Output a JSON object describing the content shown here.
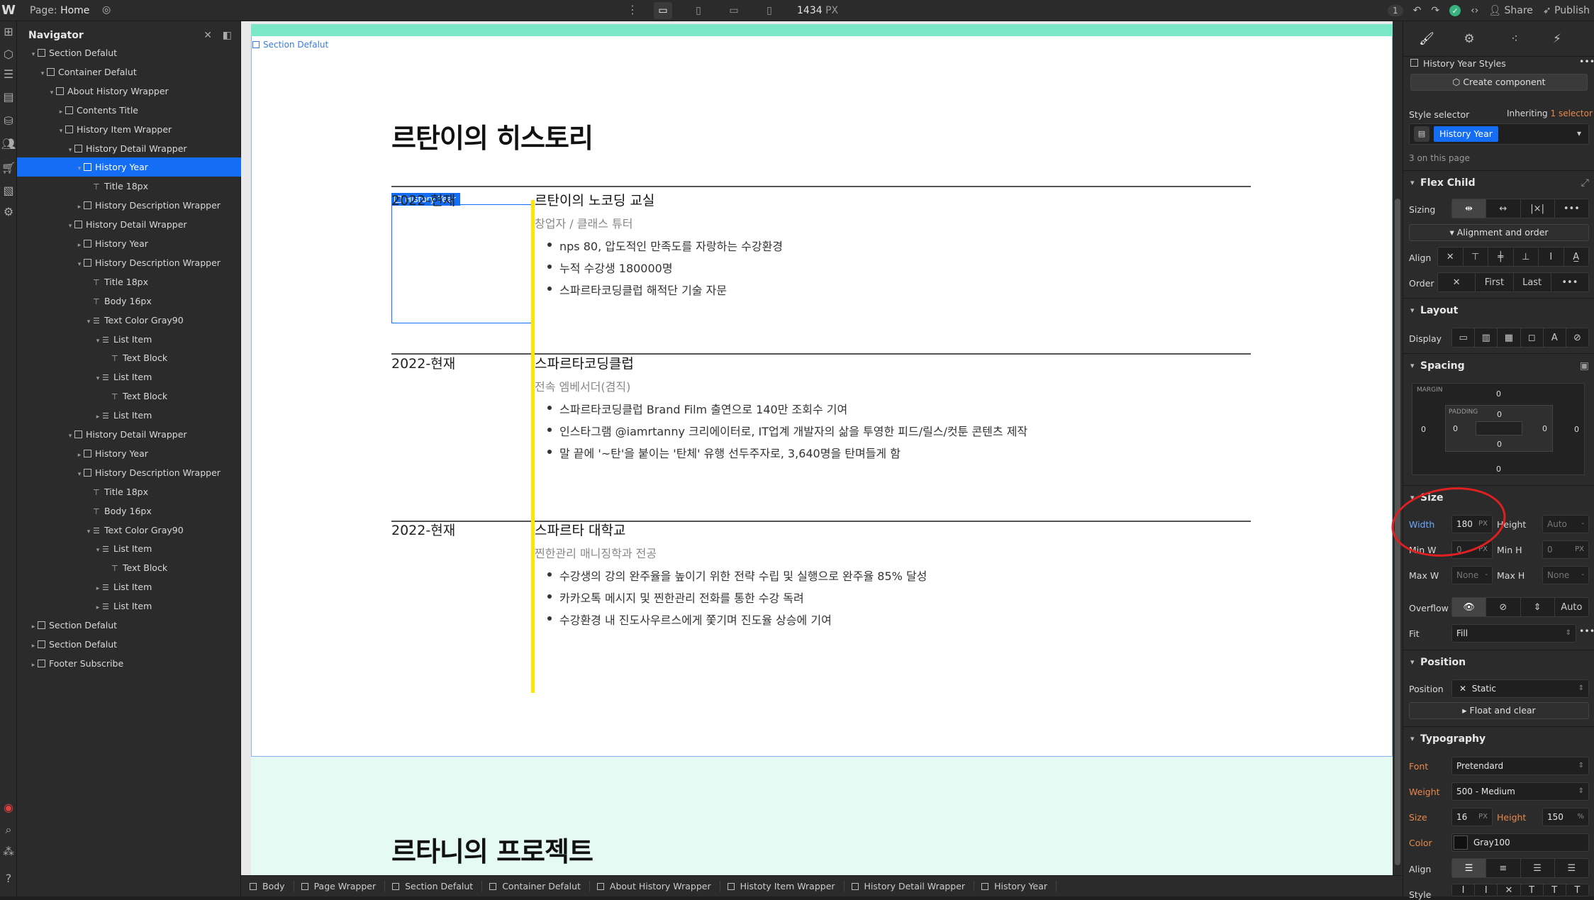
{
  "topbar": {
    "page_prefix": "Page:",
    "page_name": "Home",
    "width_value": "1434",
    "width_unit": "PX",
    "notifications": "1",
    "share": "Share",
    "publish": "Publish"
  },
  "navigator": {
    "title": "Navigator",
    "items": [
      {
        "label": "Section Defalut",
        "depth": 1,
        "kind": "box",
        "open": true
      },
      {
        "label": "Container Defalut",
        "depth": 2,
        "kind": "box",
        "open": true
      },
      {
        "label": "About History Wrapper",
        "depth": 3,
        "kind": "box",
        "open": true
      },
      {
        "label": "Contents Title",
        "depth": 4,
        "kind": "box",
        "open": false
      },
      {
        "label": "History Item Wrapper",
        "depth": 4,
        "kind": "box",
        "open": true
      },
      {
        "label": "History Detail Wrapper",
        "depth": 5,
        "kind": "box",
        "open": true
      },
      {
        "label": "History Year",
        "depth": 6,
        "kind": "box",
        "open": true,
        "selected": true
      },
      {
        "label": "Title 18px",
        "depth": 7,
        "kind": "text"
      },
      {
        "label": "History Description Wrapper",
        "depth": 6,
        "kind": "box",
        "open": false
      },
      {
        "label": "History Detail Wrapper",
        "depth": 5,
        "kind": "box",
        "open": true
      },
      {
        "label": "History Year",
        "depth": 6,
        "kind": "box",
        "open": false
      },
      {
        "label": "History Description Wrapper",
        "depth": 6,
        "kind": "box",
        "open": true
      },
      {
        "label": "Title 18px",
        "depth": 7,
        "kind": "text"
      },
      {
        "label": "Body 16px",
        "depth": 7,
        "kind": "text"
      },
      {
        "label": "Text Color Gray90",
        "depth": 7,
        "kind": "list",
        "open": true
      },
      {
        "label": "List Item",
        "depth": 8,
        "kind": "list",
        "open": true
      },
      {
        "label": "Text Block",
        "depth": 9,
        "kind": "text"
      },
      {
        "label": "List Item",
        "depth": 8,
        "kind": "list",
        "open": true
      },
      {
        "label": "Text Block",
        "depth": 9,
        "kind": "text"
      },
      {
        "label": "List Item",
        "depth": 8,
        "kind": "list",
        "open": false
      },
      {
        "label": "History Detail Wrapper",
        "depth": 5,
        "kind": "box",
        "open": true
      },
      {
        "label": "History Year",
        "depth": 6,
        "kind": "box",
        "open": false
      },
      {
        "label": "History Description Wrapper",
        "depth": 6,
        "kind": "box",
        "open": true
      },
      {
        "label": "Title 18px",
        "depth": 7,
        "kind": "text"
      },
      {
        "label": "Body 16px",
        "depth": 7,
        "kind": "text"
      },
      {
        "label": "Text Color Gray90",
        "depth": 7,
        "kind": "list",
        "open": true
      },
      {
        "label": "List Item",
        "depth": 8,
        "kind": "list",
        "open": true
      },
      {
        "label": "Text Block",
        "depth": 9,
        "kind": "text"
      },
      {
        "label": "List Item",
        "depth": 8,
        "kind": "list",
        "open": false
      },
      {
        "label": "List Item",
        "depth": 8,
        "kind": "list",
        "open": false
      },
      {
        "label": "Section Defalut",
        "depth": 1,
        "kind": "box",
        "open": false
      },
      {
        "label": "Section Defalut",
        "depth": 1,
        "kind": "box",
        "open": false
      },
      {
        "label": "Footer Subscribe",
        "depth": 1,
        "kind": "box",
        "open": false
      }
    ]
  },
  "canvas": {
    "section_label": "Section Defalut",
    "heading": "르탄이의 히스토리",
    "selected_tag": "History Year",
    "entries": [
      {
        "year": "2022-현재",
        "title": "르탄이의 노코딩 교실",
        "role": "창업자 / 클래스 튜터",
        "bullets": [
          "nps 80, 압도적인 만족도를 자랑하는 수강환경",
          "누적 수강생 180000명",
          "스파르타코딩클럽 해적단 기술 자문"
        ]
      },
      {
        "year": "2022-현재",
        "title": "스파르타코딩클럽",
        "role": "전속 엠베서더(겸직)",
        "bullets": [
          "스파르타코딩클럽 Brand Film 출연으로 140만 조회수 기여",
          "인스타그램 @iamrtanny 크리에이터로, IT업계 개발자의 삶을 투영한 피드/릴스/컷툰 콘텐츠 제작",
          "말 끝에 '~탄'을 붙이는 '탄체' 유행 선두주자로, 3,640명을 탄며들게 함"
        ]
      },
      {
        "year": "2022-현재",
        "title": "스파르타 대학교",
        "role": "찐한관리 매니징학과 전공",
        "bullets": [
          "수강생의 강의 완주율을 높이기 위한 전략 수립 및 실행으로 완주율 85% 달성",
          "카카오톡 메시지 및 찐한관리 전화를 통한 수강 독려",
          "수강환경 내 진도사우르스에게 쫓기며 진도율 상승에 기여"
        ]
      }
    ],
    "heading2": "르타니의 프로젝트"
  },
  "breadcrumbs": [
    "Body",
    "Page Wrapper",
    "Section Defalut",
    "Container Defalut",
    "About History Wrapper",
    "Histoty Item Wrapper",
    "History Detail Wrapper",
    "History Year"
  ],
  "style_panel": {
    "styles_title": "History Year Styles",
    "create_component": "Create component",
    "style_selector_label": "Style selector",
    "inheriting": "Inheriting",
    "inheriting_count": "1 selector",
    "selector_chip": "History Year",
    "on_page": "3 on this page",
    "flex_child": "Flex Child",
    "sizing": "Sizing",
    "alignment_order": "Alignment and order",
    "align": "Align",
    "order": "Order",
    "order_first": "First",
    "order_last": "Last",
    "layout": "Layout",
    "display": "Display",
    "spacing": "Spacing",
    "margin": "MARGIN",
    "padding": "PADDING",
    "margin_top": "0",
    "margin_right": "0",
    "margin_bottom": "0",
    "margin_left": "0",
    "padding_top": "0",
    "padding_right": "0",
    "padding_bottom": "0",
    "padding_left": "0",
    "size": "Size",
    "width_label": "Width",
    "width_value": "180",
    "width_unit": "PX",
    "height_label": "Height",
    "height_value": "Auto",
    "minw_label": "Min W",
    "minw_value": "0",
    "minw_unit": "PX",
    "minh_label": "Min H",
    "minh_value": "0",
    "minh_unit": "PX",
    "maxw_label": "Max W",
    "maxw_value": "None",
    "maxh_label": "Max H",
    "maxh_value": "None",
    "overflow": "Overflow",
    "overflow_auto": "Auto",
    "fit": "Fit",
    "fit_value": "Fill",
    "position": "Position",
    "position_label": "Position",
    "position_value": "Static",
    "float_clear": "Float and clear",
    "typography": "Typography",
    "font_label": "Font",
    "font_value": "Pretendard",
    "weight_label": "Weight",
    "weight_value": "500 - Medium",
    "size_label": "Size",
    "size_value": "16",
    "size_unit": "PX",
    "lineheight_label": "Height",
    "lineheight_value": "150",
    "lineheight_unit": "%",
    "color_label": "Color",
    "color_value": "Gray100",
    "align_label": "Align",
    "style_label": "Style"
  },
  "colors": {
    "accent": "#146ef5",
    "highlight_yellow": "#ffe600",
    "annotation_red": "#e02020",
    "section_green": "#7be9c7"
  }
}
